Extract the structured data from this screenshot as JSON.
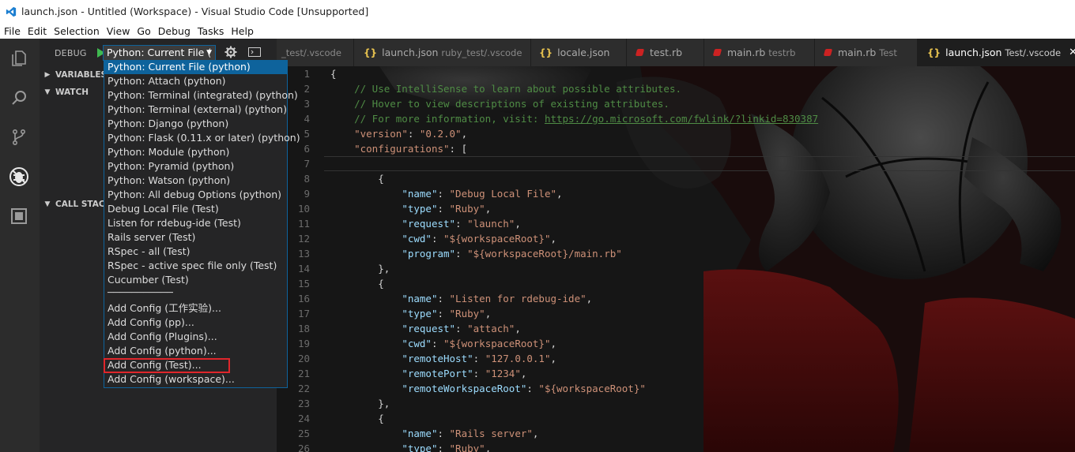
{
  "window": {
    "title": "launch.json - Untitled (Workspace) - Visual Studio Code [Unsupported]"
  },
  "menu": [
    "File",
    "Edit",
    "Selection",
    "View",
    "Go",
    "Debug",
    "Tasks",
    "Help"
  ],
  "activity_bar": {
    "icons": [
      "explorer-icon",
      "search-icon",
      "source-control-icon",
      "debug-icon",
      "extensions-icon"
    ]
  },
  "debug": {
    "label": "DEBUG",
    "selected_config": "Python: Current File (",
    "sections": {
      "variables": "VARIABLES",
      "watch": "WATCH",
      "call_stack": "CALL STACK"
    }
  },
  "dropdown": {
    "items": [
      "Python: Current File (python)",
      "Python: Attach (python)",
      "Python: Terminal (integrated) (python)",
      "Python: Terminal (external) (python)",
      "Python: Django (python)",
      "Python: Flask (0.11.x or later) (python)",
      "Python: Module (python)",
      "Python: Pyramid (python)",
      "Python: Watson (python)",
      "Python: All debug Options (python)",
      "Debug Local File (Test)",
      "Listen for rdebug-ide (Test)",
      "Rails server (Test)",
      "RSpec - all (Test)",
      "RSpec - active spec file only (Test)",
      "Cucumber (Test)",
      "───────────",
      "Add Config (工作实验)...",
      "Add Config (pp)...",
      "Add Config (Plugins)...",
      "Add Config (python)...",
      "Add Config (Test)...",
      "Add Config (workspace)..."
    ],
    "selected_index": 0,
    "highlighted_index": 21
  },
  "tabs": [
    {
      "name": "",
      "desc": "_test/.vscode",
      "kind": "partial"
    },
    {
      "name": "launch.json",
      "desc": "ruby_test/.vscode",
      "kind": "json"
    },
    {
      "name": "locale.json",
      "desc": "",
      "kind": "json"
    },
    {
      "name": "test.rb",
      "desc": "",
      "kind": "ruby"
    },
    {
      "name": "main.rb",
      "desc": "testrb",
      "kind": "ruby"
    },
    {
      "name": "main.rb",
      "desc": "Test",
      "kind": "ruby"
    },
    {
      "name": "launch.json",
      "desc": "Test/.vscode",
      "kind": "json",
      "active": true
    }
  ],
  "editor": {
    "lines": [
      {
        "n": "1",
        "t": "{"
      },
      {
        "n": "2",
        "t": "    // Use IntelliSense to learn about possible attributes."
      },
      {
        "n": "3",
        "t": "    // Hover to view descriptions of existing attributes."
      },
      {
        "n": "4",
        "t": "    // For more information, visit: https://go.microsoft.com/fwlink/?linkid=830387"
      },
      {
        "n": "5",
        "t": "    \"version\": \"0.2.0\","
      },
      {
        "n": "6",
        "t": "    \"configurations\": ["
      },
      {
        "n": "7",
        "t": ""
      },
      {
        "n": "8",
        "t": "        {"
      },
      {
        "n": "9",
        "t": "            \"name\": \"Debug Local File\","
      },
      {
        "n": "10",
        "t": "            \"type\": \"Ruby\","
      },
      {
        "n": "11",
        "t": "            \"request\": \"launch\","
      },
      {
        "n": "12",
        "t": "            \"cwd\": \"${workspaceRoot}\","
      },
      {
        "n": "13",
        "t": "            \"program\": \"${workspaceRoot}/main.rb\""
      },
      {
        "n": "14",
        "t": "        },"
      },
      {
        "n": "15",
        "t": "        {"
      },
      {
        "n": "16",
        "t": "            \"name\": \"Listen for rdebug-ide\","
      },
      {
        "n": "17",
        "t": "            \"type\": \"Ruby\","
      },
      {
        "n": "18",
        "t": "            \"request\": \"attach\","
      },
      {
        "n": "19",
        "t": "            \"cwd\": \"${workspaceRoot}\","
      },
      {
        "n": "20",
        "t": "            \"remoteHost\": \"127.0.0.1\","
      },
      {
        "n": "21",
        "t": "            \"remotePort\": \"1234\","
      },
      {
        "n": "22",
        "t": "            \"remoteWorkspaceRoot\": \"${workspaceRoot}\""
      },
      {
        "n": "23",
        "t": "        },"
      },
      {
        "n": "24",
        "t": "        {"
      },
      {
        "n": "25",
        "t": "            \"name\": \"Rails server\","
      },
      {
        "n": "26",
        "t": "            \"type\": \"Ruby\","
      }
    ]
  },
  "colors": {
    "accent": "#0e639c",
    "highlight_box": "#e0262b",
    "comment": "#4f8c45",
    "key": "#9cdcfe",
    "string": "#ce9178"
  }
}
